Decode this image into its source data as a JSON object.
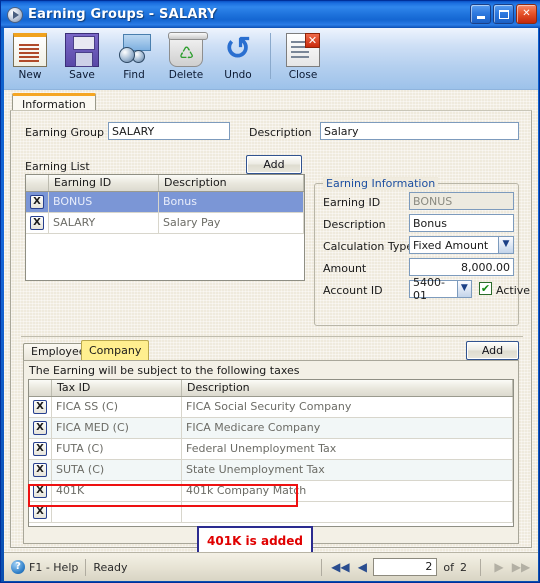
{
  "window": {
    "title": "Earning Groups - SALARY",
    "icon": "app-play-icon",
    "buttons": {
      "minimize": "_",
      "maximize": "□",
      "close": "✕"
    }
  },
  "toolbar": {
    "items": [
      {
        "label": "New",
        "icon": "new-document-icon"
      },
      {
        "label": "Save",
        "icon": "floppy-disk-icon"
      },
      {
        "label": "Find",
        "icon": "binoculars-icon"
      },
      {
        "label": "Delete",
        "icon": "recycle-bin-icon"
      },
      {
        "label": "Undo",
        "icon": "undo-arrow-icon"
      },
      {
        "label": "Close",
        "icon": "close-document-icon"
      }
    ]
  },
  "tabs": {
    "information": "Information"
  },
  "form": {
    "earning_group_label": "Earning Group",
    "earning_group_value": "SALARY",
    "description_label": "Description",
    "description_value": "Salary"
  },
  "earning_list": {
    "title": "Earning List",
    "add_label": "Add",
    "columns": [
      "",
      "Earning ID",
      "Description"
    ],
    "rows": [
      {
        "delete": "X",
        "id": "BONUS",
        "description": "Bonus",
        "selected": true
      },
      {
        "delete": "X",
        "id": "SALARY",
        "description": "Salary Pay",
        "selected": false
      }
    ]
  },
  "earning_information": {
    "legend": "Earning Information",
    "fields": [
      {
        "label": "Earning ID",
        "value": "BONUS",
        "type": "readonly"
      },
      {
        "label": "Description",
        "value": "Bonus",
        "type": "text"
      },
      {
        "label": "Calculation Type",
        "value": "Fixed Amount",
        "type": "select"
      },
      {
        "label": "Amount",
        "value": "8,000.00",
        "type": "number"
      },
      {
        "label": "Account ID",
        "value": "5400-01",
        "type": "select"
      }
    ],
    "active_label": "Active",
    "active_checked": "✔"
  },
  "taxes": {
    "tab_employee": "Employee",
    "tab_company": "Company",
    "active_tab": "Company",
    "add_label": "Add",
    "note": "The Earning will be subject to the following taxes",
    "columns": [
      "",
      "Tax ID",
      "Description"
    ],
    "rows": [
      {
        "delete": "X",
        "id": "FICA SS (C)",
        "description": "FICA Social Security Company"
      },
      {
        "delete": "X",
        "id": "FICA MED (C)",
        "description": "FICA Medicare Company"
      },
      {
        "delete": "X",
        "id": "FUTA (C)",
        "description": "Federal Unemployment Tax"
      },
      {
        "delete": "X",
        "id": "SUTA (C)",
        "description": "State Unemployment Tax"
      },
      {
        "delete": "X",
        "id": "401K",
        "description": "401k Company Match"
      },
      {
        "delete": "X",
        "id": "",
        "description": ""
      }
    ]
  },
  "annotation": {
    "callout_text": "401K is added",
    "highlight_color": "#ee1111",
    "callout_border_color": "#2b2b8f",
    "callout_text_color": "#e00000"
  },
  "statusbar": {
    "help": "F1 - Help",
    "status": "Ready",
    "nav": {
      "first": "◀◀",
      "prev": "◀",
      "current": "2",
      "of_label": "of",
      "total": "2",
      "next": "▶",
      "last": "▶▶"
    }
  },
  "colors": {
    "title_blue": "#1e72dc",
    "selection_blue": "#7b96d6",
    "tab_yellow": "#ffef8f",
    "tab_orange": "#f5a623",
    "form_beige": "#efeadd"
  }
}
